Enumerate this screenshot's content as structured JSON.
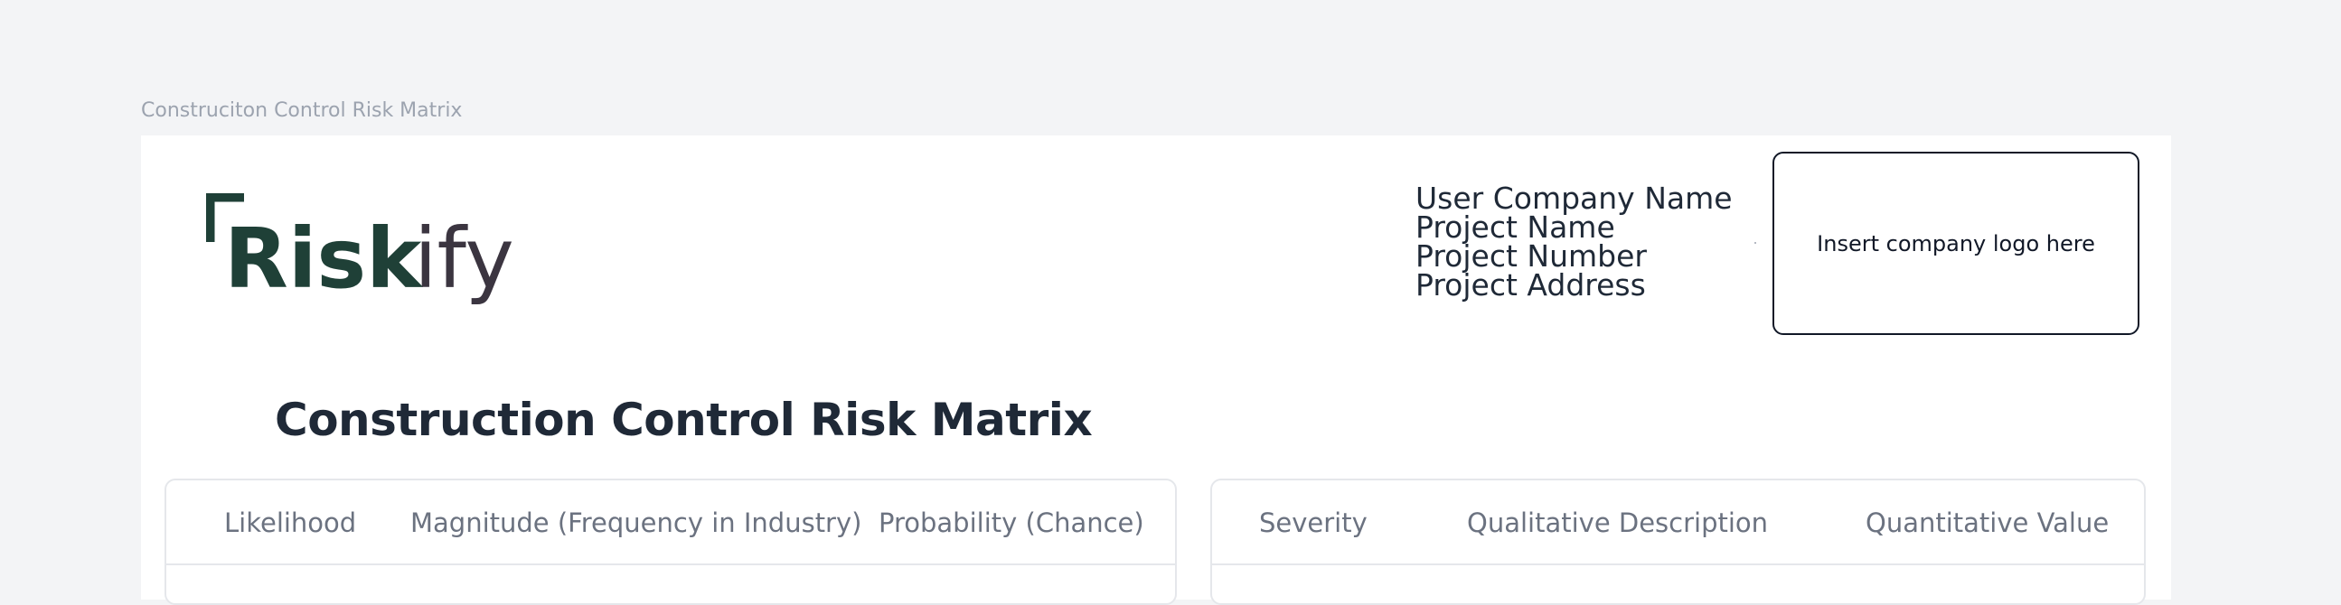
{
  "frame": {
    "label": "Construciton Control Risk Matrix"
  },
  "brand": {
    "logo_text": "Riskify",
    "colors": {
      "primary": "#1f4037",
      "accent": "#3b3540"
    }
  },
  "project": {
    "company_name": "User Company Name",
    "project_name": "Project Name",
    "project_number": "Project Number",
    "project_address": "Project Address"
  },
  "company_logo_placeholder": "Insert company logo here",
  "page_title": "Construction Control Risk Matrix",
  "likelihood_table": {
    "headers": [
      "Likelihood",
      "Magnitude (Frequency in Industry)",
      "Probability (Chance)"
    ]
  },
  "severity_table": {
    "headers": [
      "Severity",
      "Qualitative Description",
      "Quantitative Value"
    ]
  }
}
